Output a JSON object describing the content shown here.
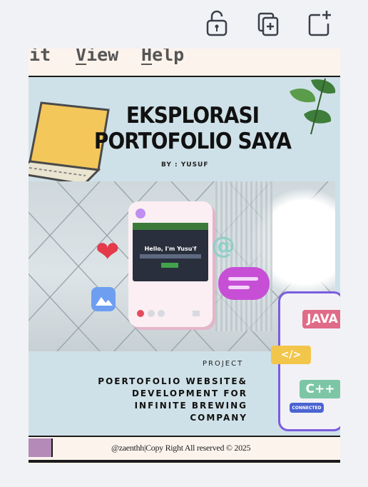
{
  "toolbar": {
    "icons": [
      "unlock-icon",
      "duplicate-page-icon",
      "add-page-icon"
    ]
  },
  "menubar": {
    "edit": "dit",
    "view_u": "V",
    "view_rest": "iew",
    "help_u": "H",
    "help_rest": "elp"
  },
  "poster": {
    "title_line1": "EKSPLORASI",
    "title_line2": "PORTOFOLIO SAYA",
    "byline": "BY : YUSUF",
    "screen_heading": "Hello, I'm Yusu'f",
    "project_label": "PROJECT",
    "desc_line1": "POERTOFOLIO WEBSITE&",
    "desc_line2": "DEVELOPMENT FOR",
    "desc_line3": "INFINITE BREWING",
    "desc_line4": "COMPANY",
    "tag_java": "JAVA",
    "tag_code": "</>",
    "tag_cpp": "C++",
    "tag_connected": "CONNECTED"
  },
  "footer": {
    "copyright": "@zaenthh|Copy Right All reserved © 2025"
  },
  "colors": {
    "poster_bg": "#cfe1e8",
    "card_bg": "#fcf3ec",
    "accent_purple": "#b48ab9"
  }
}
